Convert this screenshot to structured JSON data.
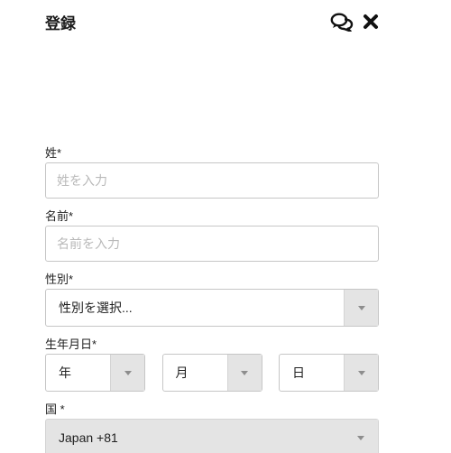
{
  "header": {
    "title": "登録"
  },
  "form": {
    "last_name": {
      "label": "姓*",
      "placeholder": "姓を入力",
      "value": ""
    },
    "first_name": {
      "label": "名前*",
      "placeholder": "名前を入力",
      "value": ""
    },
    "gender": {
      "label": "性別*",
      "selected": "性別を選択..."
    },
    "birthdate": {
      "label": "生年月日*",
      "year": "年",
      "month": "月",
      "day": "日"
    },
    "country": {
      "label": "国 *",
      "selected": "Japan +81"
    }
  },
  "icons": {
    "chat": "chat-bubbles-icon",
    "close": "close-icon"
  }
}
